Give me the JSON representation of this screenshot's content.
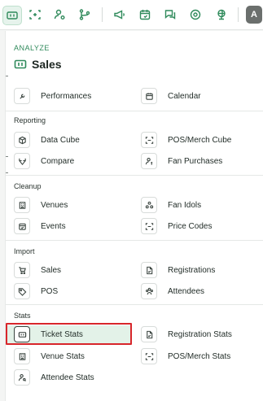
{
  "topbar": {
    "icons": [
      {
        "name": "ticket-icon",
        "active": true
      },
      {
        "name": "scan-icon",
        "active": false
      },
      {
        "name": "user-settings-icon",
        "active": false
      },
      {
        "name": "flow-icon",
        "active": false
      },
      {
        "name": "megaphone-icon",
        "active": false
      },
      {
        "name": "calendar-event-icon",
        "active": false
      },
      {
        "name": "chat-icon",
        "active": false
      },
      {
        "name": "settings-icon",
        "active": false
      },
      {
        "name": "globe-icon",
        "active": false
      }
    ],
    "avatar_initial": "A"
  },
  "panel": {
    "eyebrow": "ANALYZE",
    "title": "Sales",
    "title_icon": "ticket-icon",
    "top_items": [
      {
        "label": "Performances",
        "icon": "wrench-icon"
      },
      {
        "label": "Calendar",
        "icon": "calendar-icon"
      }
    ],
    "sections": [
      {
        "label": "Reporting",
        "items": [
          {
            "label": "Data Cube",
            "icon": "cube-icon"
          },
          {
            "label": "POS/Merch Cube",
            "icon": "scan-icon"
          },
          {
            "label": "Compare",
            "icon": "compare-icon"
          },
          {
            "label": "Fan Purchases",
            "icon": "user-dollar-icon"
          }
        ]
      },
      {
        "label": "Cleanup",
        "items": [
          {
            "label": "Venues",
            "icon": "building-icon"
          },
          {
            "label": "Fan Idols",
            "icon": "people-icon"
          },
          {
            "label": "Events",
            "icon": "calendar-check-icon"
          },
          {
            "label": "Price Codes",
            "icon": "scan-icon"
          }
        ]
      },
      {
        "label": "Import",
        "items": [
          {
            "label": "Sales",
            "icon": "cart-icon"
          },
          {
            "label": "Registrations",
            "icon": "file-icon"
          },
          {
            "label": "POS",
            "icon": "tag-icon"
          },
          {
            "label": "Attendees",
            "icon": "group-icon"
          }
        ]
      },
      {
        "label": "Stats",
        "items": [
          {
            "label": "Ticket Stats",
            "icon": "ticket-icon",
            "selected": true
          },
          {
            "label": "Registration Stats",
            "icon": "file-icon"
          },
          {
            "label": "Venue Stats",
            "icon": "building-icon"
          },
          {
            "label": "POS/Merch Stats",
            "icon": "scan-icon"
          },
          {
            "label": "Attendee Stats",
            "icon": "user-search-icon"
          }
        ]
      }
    ]
  },
  "colors": {
    "accent": "#2f8a5b",
    "selected_bg": "#e3f2e8",
    "highlight": "#d8262b"
  }
}
